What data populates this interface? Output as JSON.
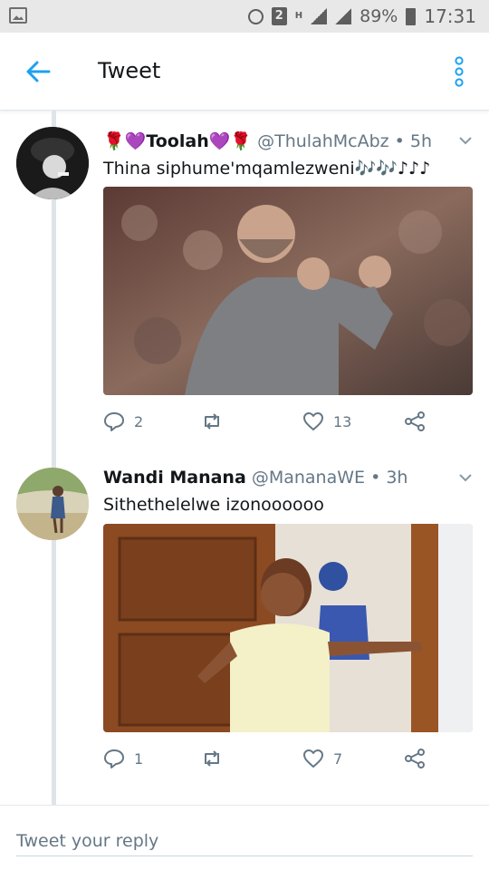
{
  "status_bar": {
    "sim_label": "2",
    "network_label": "H",
    "battery": "89%",
    "time": "17:31"
  },
  "header": {
    "title": "Tweet"
  },
  "tweets": [
    {
      "name": "🌹💜Toolah💜🌹",
      "handle": "@ThulahMcAbz",
      "time": "• 5h",
      "text": "Thina siphume'mqamlezweni🎶🎶♪♪♪",
      "replies": "2",
      "likes": "13"
    },
    {
      "name": "Wandi Manana",
      "handle": "@MananaWE",
      "time": "• 3h",
      "text": "Sithethelelwe izonoooooo",
      "replies": "1",
      "likes": "7"
    }
  ],
  "reply": {
    "placeholder": "Tweet your reply"
  },
  "colors": {
    "accent": "#1da1f2",
    "text_secondary": "#657786"
  },
  "icons": {
    "back": "arrow-left-icon",
    "more": "vertical-dots-icon",
    "reply": "speech-bubble-icon",
    "retweet": "retweet-arrows-icon",
    "like": "heart-icon",
    "share": "share-nodes-icon",
    "caret": "chevron-down-icon"
  }
}
